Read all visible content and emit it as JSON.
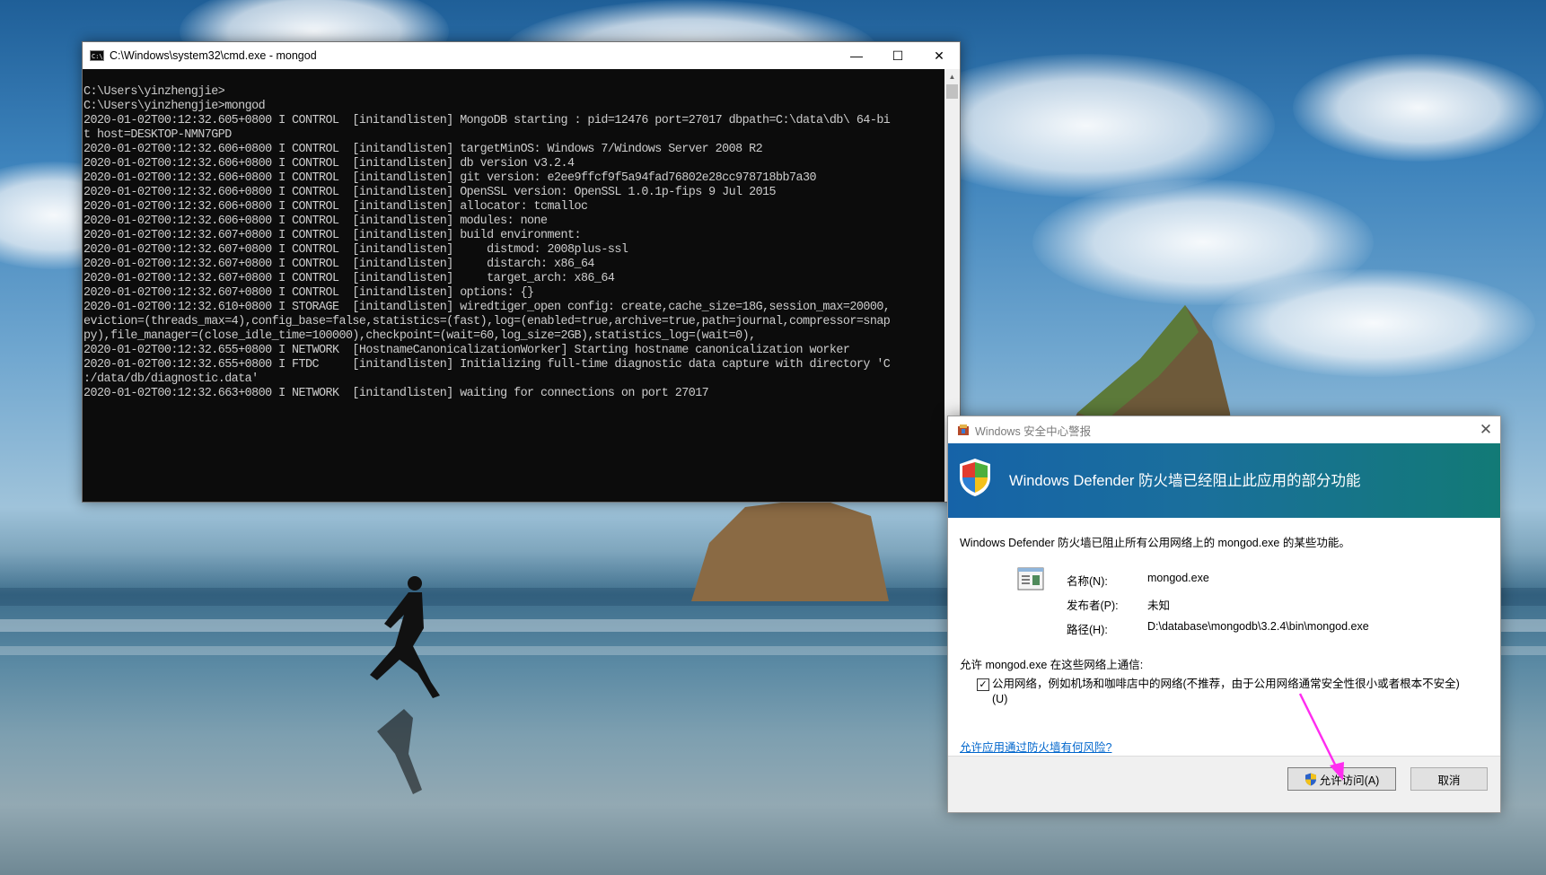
{
  "cmd_window": {
    "title": "C:\\Windows\\system32\\cmd.exe - mongod",
    "minimize_glyph": "—",
    "maximize_glyph": "☐",
    "close_glyph": "✕",
    "lines": [
      "",
      "C:\\Users\\yinzhengjie>",
      "C:\\Users\\yinzhengjie>mongod",
      "2020-01-02T00:12:32.605+0800 I CONTROL  [initandlisten] MongoDB starting : pid=12476 port=27017 dbpath=C:\\data\\db\\ 64-bi",
      "t host=DESKTOP-NMN7GPD",
      "2020-01-02T00:12:32.606+0800 I CONTROL  [initandlisten] targetMinOS: Windows 7/Windows Server 2008 R2",
      "2020-01-02T00:12:32.606+0800 I CONTROL  [initandlisten] db version v3.2.4",
      "2020-01-02T00:12:32.606+0800 I CONTROL  [initandlisten] git version: e2ee9ffcf9f5a94fad76802e28cc978718bb7a30",
      "2020-01-02T00:12:32.606+0800 I CONTROL  [initandlisten] OpenSSL version: OpenSSL 1.0.1p-fips 9 Jul 2015",
      "2020-01-02T00:12:32.606+0800 I CONTROL  [initandlisten] allocator: tcmalloc",
      "2020-01-02T00:12:32.606+0800 I CONTROL  [initandlisten] modules: none",
      "2020-01-02T00:12:32.607+0800 I CONTROL  [initandlisten] build environment:",
      "2020-01-02T00:12:32.607+0800 I CONTROL  [initandlisten]     distmod: 2008plus-ssl",
      "2020-01-02T00:12:32.607+0800 I CONTROL  [initandlisten]     distarch: x86_64",
      "2020-01-02T00:12:32.607+0800 I CONTROL  [initandlisten]     target_arch: x86_64",
      "2020-01-02T00:12:32.607+0800 I CONTROL  [initandlisten] options: {}",
      "2020-01-02T00:12:32.610+0800 I STORAGE  [initandlisten] wiredtiger_open config: create,cache_size=18G,session_max=20000,",
      "eviction=(threads_max=4),config_base=false,statistics=(fast),log=(enabled=true,archive=true,path=journal,compressor=snap",
      "py),file_manager=(close_idle_time=100000),checkpoint=(wait=60,log_size=2GB),statistics_log=(wait=0),",
      "2020-01-02T00:12:32.655+0800 I NETWORK  [HostnameCanonicalizationWorker] Starting hostname canonicalization worker",
      "2020-01-02T00:12:32.655+0800 I FTDC     [initandlisten] Initializing full-time diagnostic data capture with directory 'C",
      ":/data/db/diagnostic.data'",
      "2020-01-02T00:12:32.663+0800 I NETWORK  [initandlisten] waiting for connections on port 27017"
    ]
  },
  "security_dialog": {
    "title": "Windows 安全中心警报",
    "close_glyph": "✕",
    "banner_title": "Windows Defender 防火墙已经阻止此应用的部分功能",
    "main_text": "Windows Defender 防火墙已阻止所有公用网络上的 mongod.exe 的某些功能。",
    "fields": [
      {
        "label": "名称(N):",
        "value": "mongod.exe"
      },
      {
        "label": "发布者(P):",
        "value": "未知"
      },
      {
        "label": "路径(H):",
        "value": "D:\\database\\mongodb\\3.2.4\\bin\\mongod.exe"
      }
    ],
    "allow_text": "允许 mongod.exe 在这些网络上通信:",
    "public_network_checked": true,
    "check_glyph": "✓",
    "public_network_label": "公用网络，例如机场和咖啡店中的网络(不推荐，由于公用网络通常安全性很小或者根本不安全)",
    "public_network_label_line2": "(U)",
    "risk_link": "允许应用通过防火墙有何风险?",
    "allow_button": "允许访问(A)",
    "cancel_button": "取消"
  },
  "colors": {
    "annotation_arrow": "#ff2df0",
    "banner_start": "#1663a8",
    "banner_end": "#127a76",
    "link": "#0066cc"
  },
  "icons": {
    "cmd": "cmd-icon",
    "dialog_title": "security-center-icon",
    "banner": "windows-security-shield-icon",
    "app": "application-icon",
    "uac": "uac-shield-icon"
  }
}
